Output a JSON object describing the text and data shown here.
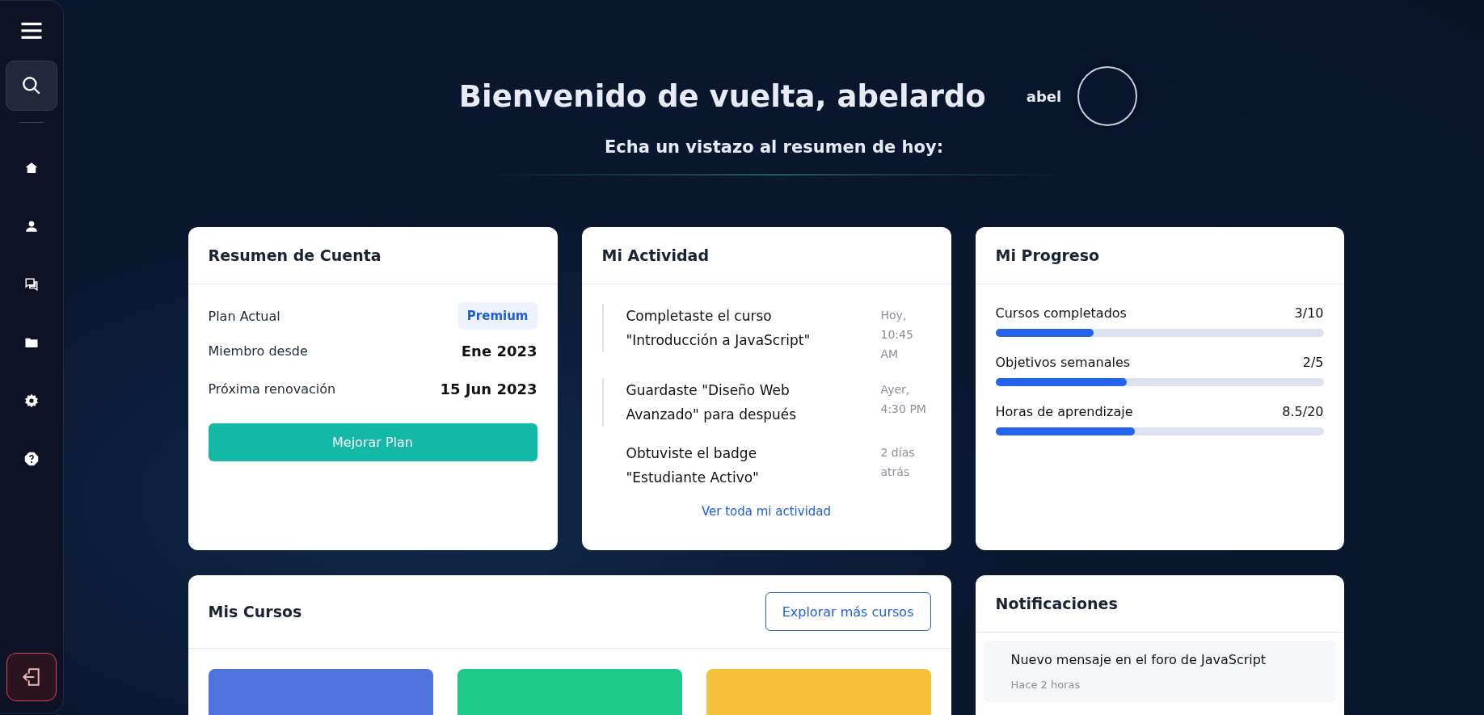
{
  "header": {
    "title": "Bienvenido de vuelta, abelardo",
    "username": "abel",
    "subtitle": "Echa un vistazo al resumen de hoy:"
  },
  "account": {
    "title": "Resumen de Cuenta",
    "rows": [
      {
        "label": "Plan Actual",
        "value": "Premium",
        "kind": "badge"
      },
      {
        "label": "Miembro desde",
        "value": "Ene 2023",
        "kind": "text"
      },
      {
        "label": "Próxima renovación",
        "value": "15 Jun 2023",
        "kind": "text"
      }
    ],
    "button": "Mejorar Plan"
  },
  "activity": {
    "title": "Mi Actividad",
    "items": [
      {
        "text": "Completaste el curso \"Introducción a JavaScript\"",
        "time": "Hoy, 10:45 AM",
        "highlighted": true
      },
      {
        "text": "Guardaste \"Diseño Web Avanzado\" para después",
        "time": "Ayer, 4:30 PM",
        "highlighted": true
      },
      {
        "text": "Obtuviste el badge \"Estudiante Activo\"",
        "time": "2 días atrás",
        "highlighted": false
      }
    ],
    "link": "Ver toda mi actividad"
  },
  "progress": {
    "title": "Mi Progreso",
    "items": [
      {
        "label": "Cursos completados",
        "reading": "3/10",
        "level": 0.3
      },
      {
        "label": "Objetivos semanales",
        "reading": "2/5",
        "level": 0.4
      },
      {
        "label": "Horas de aprendizaje",
        "reading": "8.5/20",
        "level": 0.425
      }
    ]
  },
  "courses": {
    "title": "Mis Cursos",
    "button": "Explorar más cursos",
    "tiles": [
      {
        "color": "#4f73dc"
      },
      {
        "color": "#1ec98a"
      },
      {
        "color": "#f5c03c"
      }
    ]
  },
  "notifications": {
    "title": "Notificaciones",
    "items": [
      {
        "text": "Nuevo mensaje en el foro de JavaScript",
        "time": "Hace 2 horas"
      }
    ]
  }
}
